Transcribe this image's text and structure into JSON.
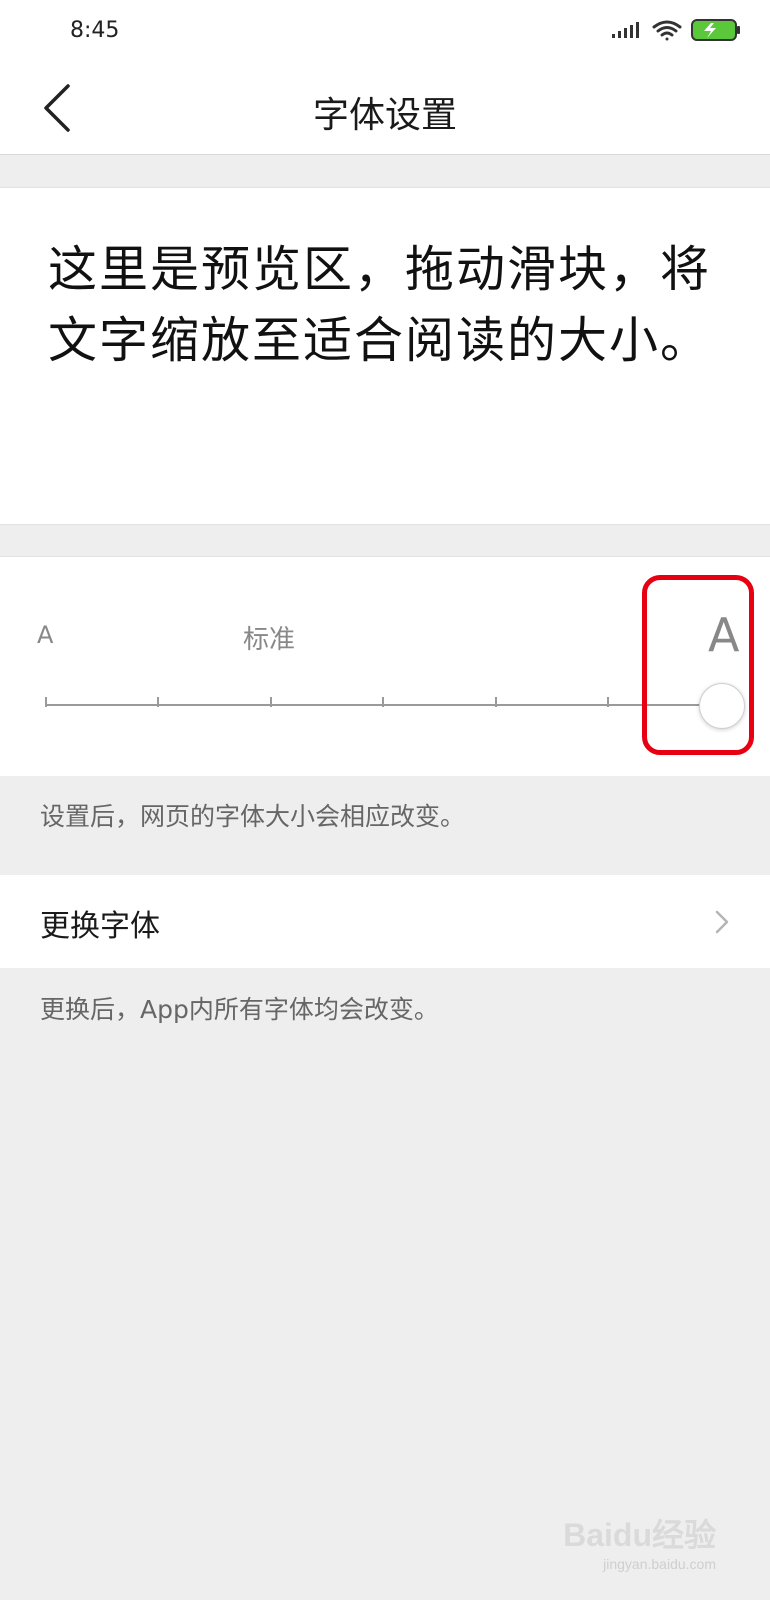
{
  "status_bar": {
    "time": "8:45",
    "icons": [
      "signal-icon",
      "wifi-icon",
      "battery-charging-icon"
    ]
  },
  "nav": {
    "title": "字体设置",
    "back_icon": "back-chevron-icon"
  },
  "preview": {
    "text": "这里是预览区，拖动滑块，将文字缩放至适合阅读的大小。"
  },
  "font_size_slider": {
    "label_small": "A",
    "label_standard": "标准",
    "label_large": "A",
    "steps": 7,
    "selected_index": 6,
    "highlight_color": "#e60012"
  },
  "notes": {
    "font_size_note": "设置后，网页的字体大小会相应改变。",
    "change_font_note": "更换后，App内所有字体均会改变。"
  },
  "change_font": {
    "label": "更换字体",
    "chevron_icon": "chevron-right-icon"
  },
  "watermark": {
    "brand": "Baidu经验",
    "sub": "jingyan.baidu.com"
  },
  "colors": {
    "background": "#eeeeee",
    "panel": "#ffffff",
    "battery_green": "#5ac83a",
    "highlight": "#e60012"
  }
}
